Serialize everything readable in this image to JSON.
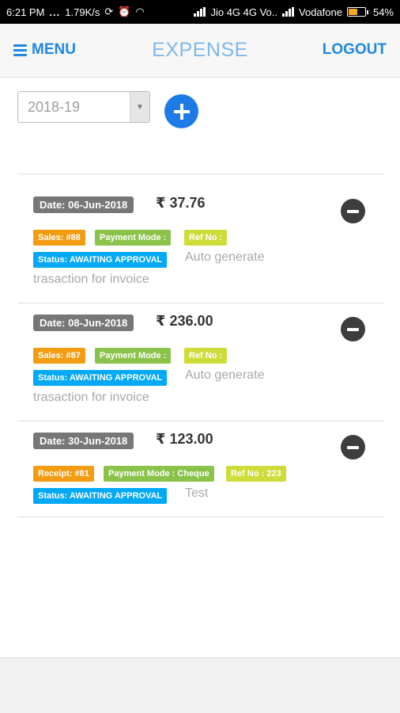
{
  "status_bar": {
    "time": "6:21 PM",
    "dots": "...",
    "speed": "1.79K/s",
    "carrier1": "Jio 4G 4G Vo..",
    "carrier2": "Vodafone",
    "battery": "54%",
    "battery_level": 0.54,
    "icons": [
      "sync-icon",
      "alarm-icon",
      "wifi-icon",
      "signal-icon",
      "battery-icon"
    ]
  },
  "header": {
    "menu_label": "MENU",
    "title": "EXPENSE",
    "logout_label": "LOGOUT",
    "accent": "#1e88e5",
    "title_color": "#7fb8ec"
  },
  "filter": {
    "year": "2018-19"
  },
  "entries": [
    {
      "date": "Date: 06-Jun-2018",
      "amount": "₹ 37.76",
      "tags": [
        "Sales: #88",
        "Payment Mode :",
        "Ref No :"
      ],
      "status": "Status: AWAITING APPROVAL",
      "description": "Auto generate trasaction for invoice"
    },
    {
      "date": "Date: 08-Jun-2018",
      "amount": "₹ 236.00",
      "tags": [
        "Sales: #87",
        "Payment Mode :",
        "Ref No :"
      ],
      "status": "Status: AWAITING APPROVAL",
      "description": "Auto generate trasaction for invoice"
    },
    {
      "date": "Date: 30-Jun-2018",
      "amount": "₹ 123.00",
      "tags": [
        "Receipt: #81",
        "Payment Mode : Cheque",
        "Ref No : 223"
      ],
      "status": "Status: AWAITING APPROVAL",
      "description": "Test"
    }
  ],
  "colors": {
    "tag_orange": "#f39c12",
    "tag_green": "#8bc34a",
    "tag_lime": "#cddc39",
    "tag_blue": "#03a9f4",
    "date_tag": "#777777"
  }
}
